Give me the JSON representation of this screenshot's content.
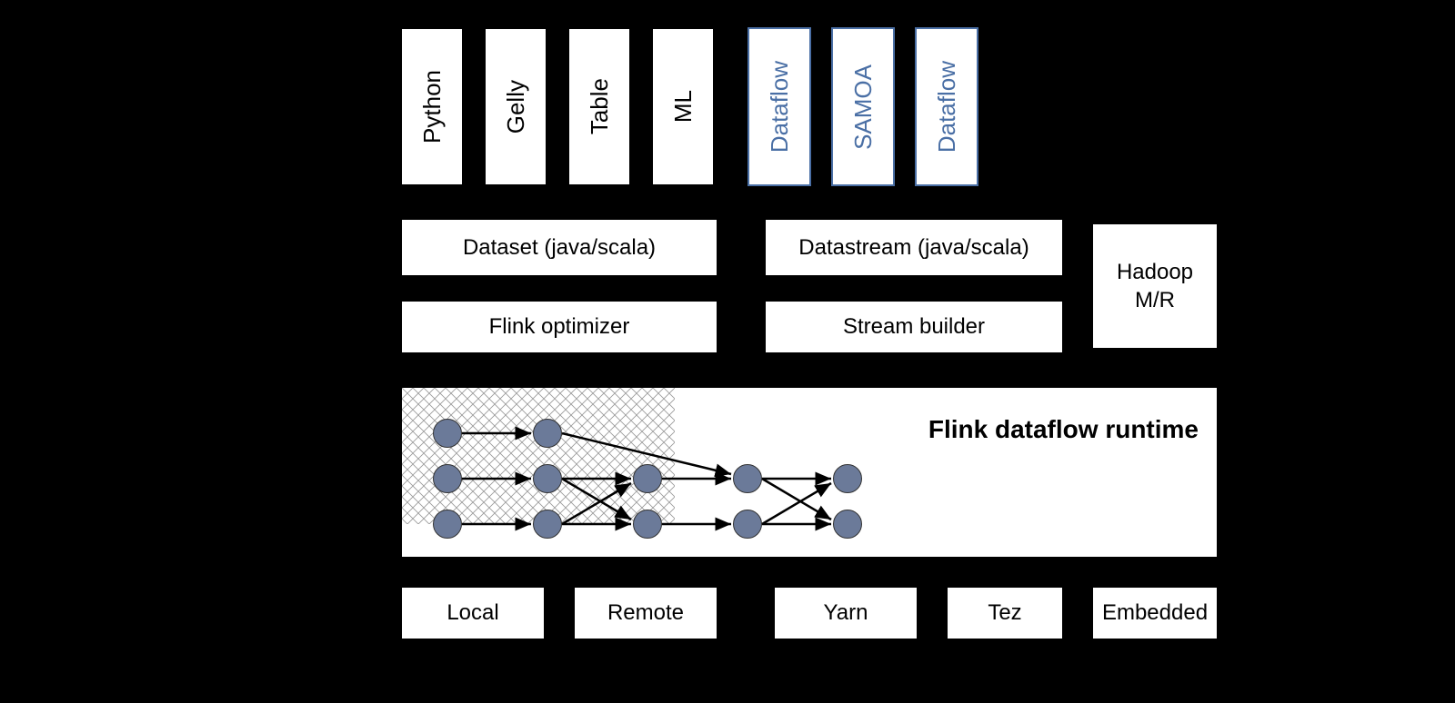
{
  "topRow": {
    "python": "Python",
    "gelly": "Gelly",
    "table": "Table",
    "ml": "ML",
    "dataflow1": "Dataflow",
    "samoa": "SAMOA",
    "dataflow2": "Dataflow"
  },
  "apiRow": {
    "dataset": "Dataset (java/scala)",
    "datastream": "Datastream (java/scala)"
  },
  "optRow": {
    "optimizer": "Flink optimizer",
    "streamBuilder": "Stream builder"
  },
  "hadoop": {
    "line1": "Hadoop",
    "line2": "M/R"
  },
  "runtime": "Flink dataflow runtime",
  "bottomRow": {
    "local": "Local",
    "remote": "Remote",
    "yarn": "Yarn",
    "tez": "Tez",
    "embedded": "Embedded"
  }
}
